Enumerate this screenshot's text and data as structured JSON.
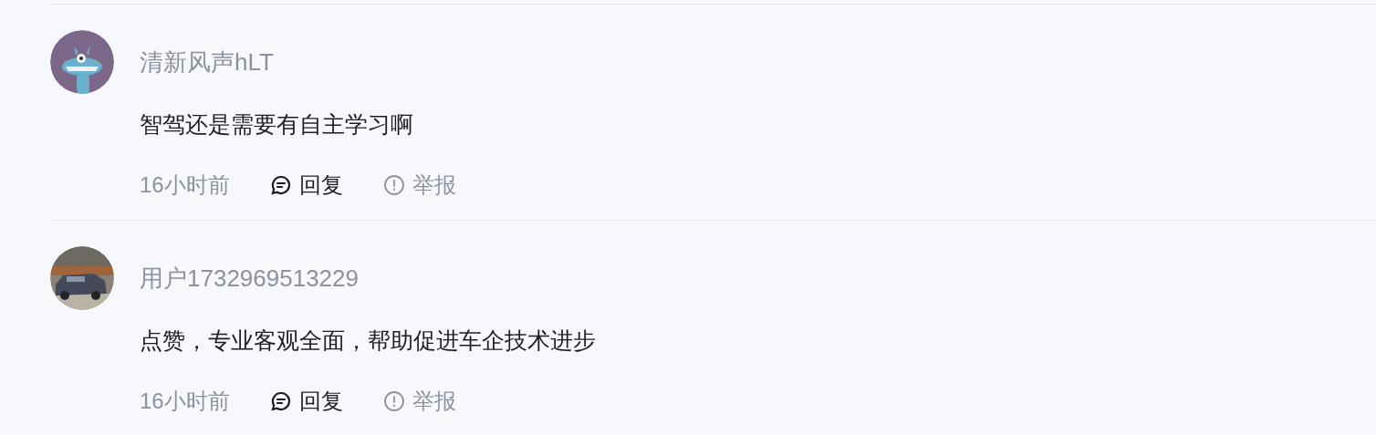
{
  "comments": [
    {
      "avatar": {
        "kind": "cartoon"
      },
      "author": "清新风声hLT",
      "text": "智驾还是需要有自主学习啊",
      "time": "16小时前",
      "reply": "回复",
      "report": "举报"
    },
    {
      "author": "用户1732969513229",
      "text": "点赞，专业客观全面，帮助促进车企技术进步",
      "time": "16小时前",
      "reply": "回复",
      "report": "举报"
    }
  ]
}
